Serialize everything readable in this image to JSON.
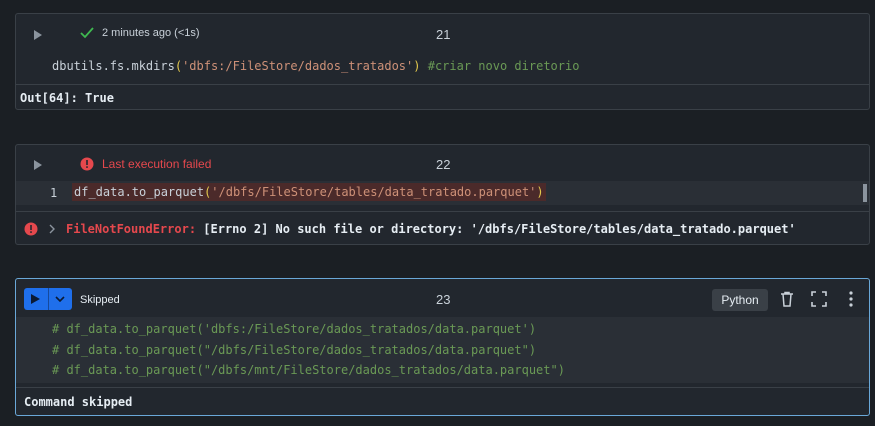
{
  "cells": [
    {
      "number": "21",
      "status": "2 minutes ago (<1s)",
      "code_fn": "dbutils.fs.mkdirs",
      "code_arg": "'dbfs:/FileStore/dados_tratados'",
      "code_comment": "#criar novo diretorio",
      "output": "Out[64]: True"
    },
    {
      "number": "22",
      "status": "Last execution failed",
      "line_number": "1",
      "code_fn": "df_data.to_parquet",
      "code_arg": "'/dbfs/FileStore/tables/data_tratado.parquet'",
      "error_type": "FileNotFoundError:",
      "error_msg": "[Errno 2] No such file or directory: '/dbfs/FileStore/tables/data_tratado.parquet'"
    },
    {
      "number": "23",
      "status": "Skipped",
      "language": "Python",
      "lines": [
        "# df_data.to_parquet('dbfs:/FileStore/dados_tratados/data.parquet')",
        "# df_data.to_parquet(\"/dbfs/FileStore/dados_tratados/data.parquet\")",
        "# df_data.to_parquet(\"/dbfs/mnt/FileStore/dados_tratados/data.parquet\")"
      ],
      "output": "Command skipped"
    }
  ],
  "icons": {
    "success": "check-icon",
    "error": "error-circle-icon",
    "delete": "trash-icon",
    "fullscreen": "expand-icon",
    "more": "kebab-icon"
  },
  "colors": {
    "accent": "#1f6feb",
    "error": "#e5484d",
    "success": "#3fb950",
    "selected_border": "#6aa8d8"
  }
}
